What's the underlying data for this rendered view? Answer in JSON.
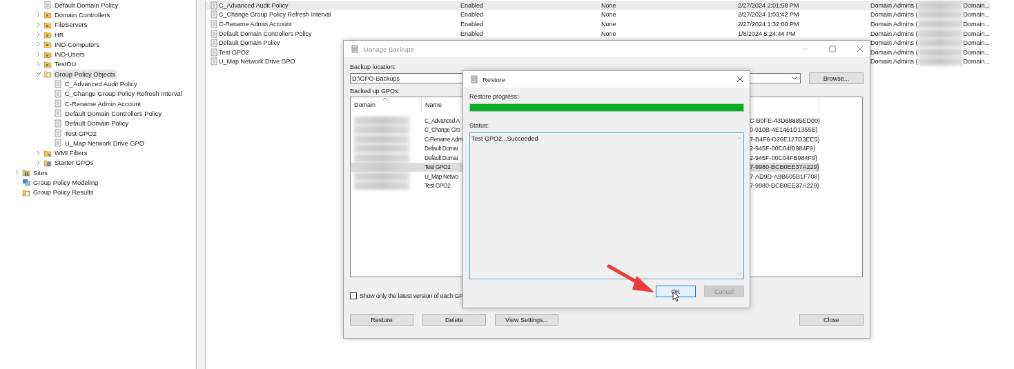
{
  "tree": [
    {
      "children": [
        {
          "label": "Default Domain Policy",
          "kind": "gpo-link",
          "selected": false
        },
        {
          "label": "Domain Controllers",
          "kind": "ou",
          "expanded": false,
          "selected": false
        },
        {
          "label": "FileServers",
          "kind": "ou",
          "expanded": false,
          "selected": false
        },
        {
          "label": "HR",
          "kind": "ou",
          "expanded": false,
          "selected": false
        },
        {
          "label": "IND-Computers",
          "kind": "ou",
          "expanded": false,
          "selected": false
        },
        {
          "label": "IND-Users",
          "kind": "ou",
          "expanded": false,
          "selected": false
        },
        {
          "label": "TestOU",
          "kind": "ou",
          "expanded": false,
          "selected": false
        },
        {
          "label": "Group Policy Objects",
          "kind": "gpo-folder",
          "expanded": true,
          "selected": true,
          "children": [
            {
              "label": "C_Advanced Audit Policy",
              "kind": "gpo",
              "selected": false
            },
            {
              "label": "C_Change Group Policy Refresh Interval",
              "kind": "gpo",
              "selected": false
            },
            {
              "label": "C-Rename Admin Account",
              "kind": "gpo",
              "selected": false
            },
            {
              "label": "Default Domain Controllers Policy",
              "kind": "gpo",
              "selected": false
            },
            {
              "label": "Default Domain Policy",
              "kind": "gpo",
              "selected": false
            },
            {
              "label": "Test GPO2",
              "kind": "gpo",
              "selected": false
            },
            {
              "label": "U_Map Network Drive GPO",
              "kind": "gpo",
              "selected": false
            }
          ]
        },
        {
          "label": "WMI Filters",
          "kind": "wmi",
          "expanded": false,
          "selected": false
        },
        {
          "label": "Starter GPOs",
          "kind": "starter",
          "expanded": false,
          "selected": false
        }
      ]
    },
    {
      "label": "Sites",
      "kind": "sites",
      "expanded": false,
      "selected": false
    },
    {
      "label": "Group Policy Modeling",
      "kind": "modeling",
      "selected": false
    },
    {
      "label": "Group Policy Results",
      "kind": "results",
      "selected": false
    }
  ],
  "gpo_list": [
    {
      "name": "C_Advanced Audit Policy",
      "status": "Enabled",
      "wmi": "None",
      "modified": "2/27/2024 2:01:58 PM",
      "owner": "Domain Admins (",
      "column_6": "Domain...",
      "selected": true
    },
    {
      "name": "C_Change Group Policy Refresh Interval",
      "status": "Enabled",
      "wmi": "None",
      "modified": "2/27/2024 1:03:42 PM",
      "owner": "Domain Admins (",
      "column_6": "Domain...",
      "selected": false
    },
    {
      "name": "C-Rename Admin Account",
      "status": "Enabled",
      "wmi": "None",
      "modified": "2/27/2024 1:32:00 PM",
      "owner": "Domain Admins (",
      "column_6": "Domain...",
      "selected": false
    },
    {
      "name": "Default Domain Controllers Policy",
      "status": "Enabled",
      "wmi": "None",
      "modified": "1/8/2024 5:24:44 PM",
      "owner": "Domain Admins (",
      "column_6": "Domain...",
      "selected": false
    },
    {
      "name": "Default Domain Policy",
      "owner": "Domain Admins (",
      "column_6": "Domain...",
      "selected": false
    },
    {
      "name": "Test GPO2",
      "owner": "Domain Admins (",
      "column_6": "Domain...",
      "selected": false
    },
    {
      "name": "U_Map Network Drive GPO",
      "owner": "Domain Admins (",
      "column_6": "Domain...",
      "selected": false
    }
  ],
  "manage_backups": {
    "title": "Manage Backups",
    "location_label": "Backup location:",
    "location_value": "D:\\GPO-Backups",
    "browse": "Browse...",
    "list_label": "Backed up GPOs:",
    "columns": [
      {
        "label": "Domain",
        "sorted": true
      },
      {
        "label": "Name",
        "sorted": false
      }
    ],
    "rows": [
      {
        "name": "C_Advanced A",
        "column_3": "C-B0FE-43D68885ED00}",
        "selected": false
      },
      {
        "name": "C_Change Gro",
        "column_3": "0-910B-4E1461D1355E}",
        "selected": false
      },
      {
        "name": "C-Rename Adm",
        "column_3": "7-B4F6-D26E127D3EE5}",
        "selected": false
      },
      {
        "name": "Default Domai",
        "column_3": "2-945F-00C04fB984F9}",
        "selected": false
      },
      {
        "name": "Default Domai",
        "column_3": "2-945F-00C04FB984F9}",
        "selected": false
      },
      {
        "name": "Test GPO2",
        "column_3": "7-9980-BCB0EE37A229}",
        "selected": true
      },
      {
        "name": "U_Map Netwo",
        "column_3": "7-AD9D-A9B605B1F708}",
        "selected": false
      },
      {
        "name": "Test GPO2",
        "column_3": "7-9980-BCB0EE37A229}",
        "selected": false
      }
    ],
    "latest_only": {
      "label": "Show only the latest version of each GP",
      "checked": false
    },
    "buttons": [
      {
        "label": "Restore"
      },
      {
        "label": "Delete"
      },
      {
        "label": "View Settings..."
      }
    ],
    "close_button": "Close"
  },
  "restore": {
    "title": "Restore",
    "progress_label": "Restore progress:",
    "progress": {
      "level": 1
    },
    "status_label": "Status:",
    "status_text": "Test GPO2...Succeeded",
    "buttons": [
      {
        "label": "OK",
        "disabled": false,
        "focused": true
      },
      {
        "label": "Cancel",
        "disabled": true,
        "focused": false
      }
    ]
  }
}
